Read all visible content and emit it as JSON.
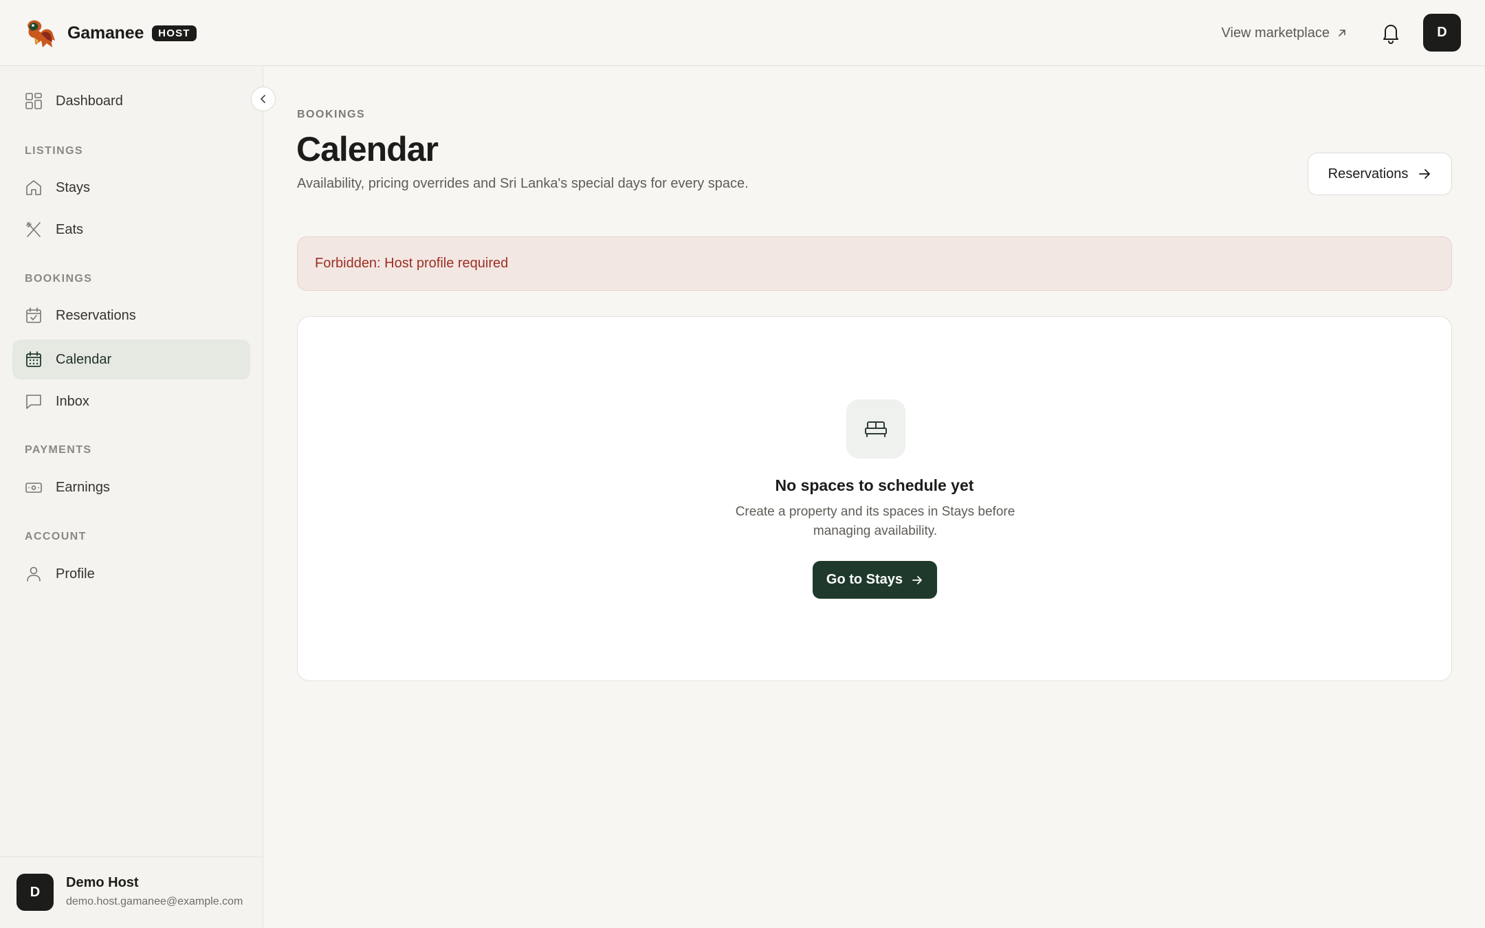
{
  "app": {
    "brand_name": "Gamanee",
    "badge": "HOST",
    "view_marketplace": "View marketplace",
    "avatar_initial": "D"
  },
  "sidebar": {
    "dashboard": "Dashboard",
    "sections": {
      "listings": "LISTINGS",
      "bookings": "BOOKINGS",
      "payments": "PAYMENTS",
      "account": "ACCOUNT"
    },
    "items": {
      "stays": "Stays",
      "eats": "Eats",
      "reservations": "Reservations",
      "calendar": "Calendar",
      "inbox": "Inbox",
      "earnings": "Earnings",
      "profile": "Profile"
    },
    "active": "calendar",
    "user": {
      "initial": "D",
      "name": "Demo Host",
      "email": "demo.host.gamanee@example.com"
    }
  },
  "main": {
    "eyebrow": "BOOKINGS",
    "title": "Calendar",
    "subtitle": "Availability, pricing overrides and Sri Lanka's special days for every space.",
    "reservations_button": "Reservations",
    "alert": "Forbidden: Host profile required",
    "empty": {
      "title": "No spaces to schedule yet",
      "description": "Create a property and its spaces in Stays before managing availability.",
      "button": "Go to Stays"
    }
  },
  "colors": {
    "accent": "#1f3a2c",
    "alert_bg": "#f3e7e4",
    "alert_text": "#9c2f22",
    "active_nav_bg": "#e6e8e2"
  }
}
